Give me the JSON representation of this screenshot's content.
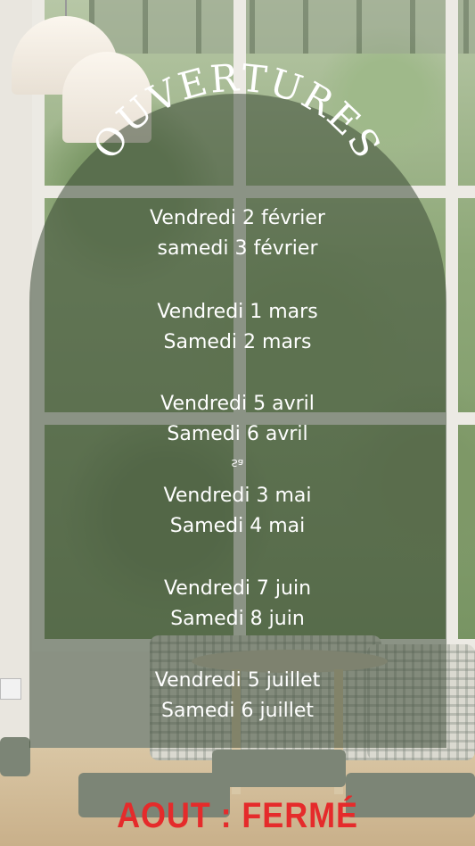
{
  "title": "OUVERTURES",
  "groups": [
    {
      "line1": "Vendredi 2 février",
      "line2": "samedi 3 février"
    },
    {
      "line1": "Vendredi 1 mars",
      "line2": "Samedi 2 mars"
    },
    {
      "line1": "Vendredi 5 avril",
      "line2": "Samedi 6 avril"
    },
    {
      "line1": "Vendredi 3 mai",
      "line2": "Samedi 4 mai"
    },
    {
      "line1": "Vendredi 7 juin",
      "line2": "Samedi 8 juin"
    },
    {
      "line1": "Vendredi 5 juillet",
      "line2": "Samedi 6 juillet"
    }
  ],
  "stray_text": "Sa",
  "closed_notice": "AOUT : FERMÉ",
  "colors": {
    "text": "#ffffff",
    "closed": "#e52b2b",
    "overlay": "#3c4b37"
  }
}
